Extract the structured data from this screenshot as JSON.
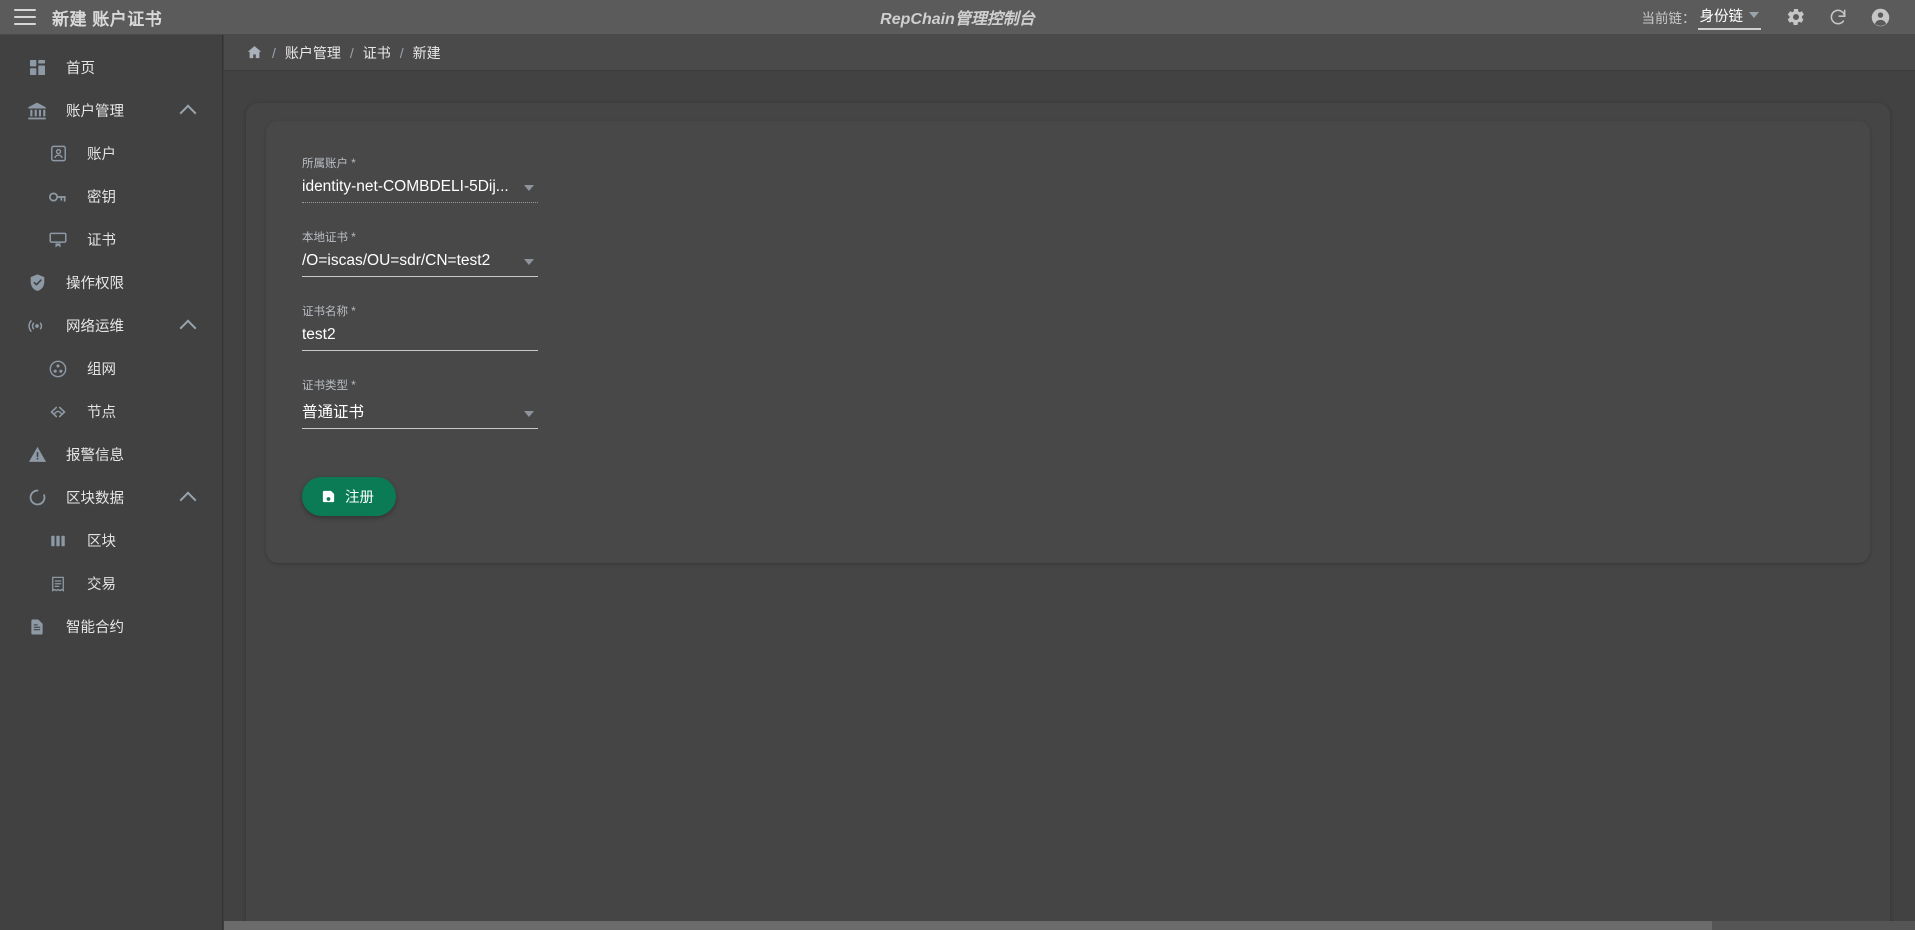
{
  "topbar": {
    "menu_icon": "hamburger-icon",
    "title": "新建 账户证书",
    "center_title": "RepChain管理控制台",
    "chain_label": "当前链：",
    "chain_value": "身份链",
    "settings_icon": "gear-icon",
    "refresh_icon": "refresh-icon",
    "account_icon": "account-circle-icon"
  },
  "sidebar": {
    "items": [
      {
        "label": "首页",
        "icon": "dashboard-icon",
        "level": 1,
        "expandable": false
      },
      {
        "label": "账户管理",
        "icon": "bank-icon",
        "level": 1,
        "expandable": true
      },
      {
        "label": "账户",
        "icon": "account-box-icon",
        "level": 2,
        "expandable": false
      },
      {
        "label": "密钥",
        "icon": "key-icon",
        "level": 2,
        "expandable": false
      },
      {
        "label": "证书",
        "icon": "certificate-monitor-icon",
        "level": 2,
        "expandable": false
      },
      {
        "label": "操作权限",
        "icon": "shield-check-icon",
        "level": 1,
        "expandable": false
      },
      {
        "label": "网络运维",
        "icon": "radio-signal-icon",
        "level": 1,
        "expandable": true
      },
      {
        "label": "组网",
        "icon": "network-nodes-icon",
        "level": 2,
        "expandable": false
      },
      {
        "label": "节点",
        "icon": "node-link-icon",
        "level": 2,
        "expandable": false
      },
      {
        "label": "报警信息",
        "icon": "alert-triangle-icon",
        "level": 1,
        "expandable": false
      },
      {
        "label": "区块数据",
        "icon": "circle-loading-icon",
        "level": 1,
        "expandable": true
      },
      {
        "label": "区块",
        "icon": "columns-icon",
        "level": 2,
        "expandable": false
      },
      {
        "label": "交易",
        "icon": "receipt-icon",
        "level": 2,
        "expandable": false
      },
      {
        "label": "智能合约",
        "icon": "file-document-icon",
        "level": 1,
        "expandable": false
      }
    ]
  },
  "breadcrumb": {
    "home_icon": "home-icon",
    "separator": "/",
    "items": [
      "账户管理",
      "证书",
      "新建"
    ]
  },
  "form": {
    "fields": [
      {
        "label": "所属账户",
        "required": "*",
        "value": "identity-net-COMBDELI-5Dij...",
        "type": "select",
        "underline": "dotted"
      },
      {
        "label": "本地证书",
        "required": "*",
        "value": "/O=iscas/OU=sdr/CN=test2",
        "type": "select",
        "underline": "solid"
      },
      {
        "label": "证书名称",
        "required": "*",
        "value": "test2",
        "type": "text",
        "underline": "solid"
      },
      {
        "label": "证书类型",
        "required": "*",
        "value": "普通证书",
        "type": "select",
        "underline": "solid"
      }
    ],
    "submit": {
      "label": "注册",
      "icon": "save-icon"
    }
  },
  "colors": {
    "accent_green": "#0a7b55",
    "topbar": "#5b5b5b",
    "sidebar": "#414141",
    "page_bg": "#424242",
    "card": "#454545",
    "inner_card": "#484848"
  }
}
